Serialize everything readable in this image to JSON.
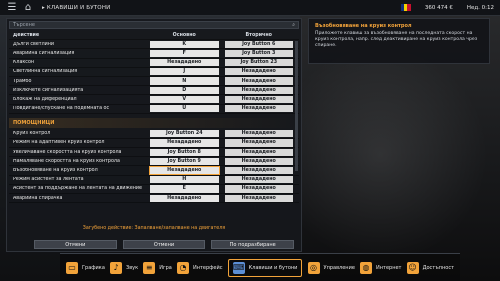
{
  "topbar": {
    "title": "КЛАВИШИ И БУТОНИ",
    "money": "360 474 €",
    "status": "Нед. 0:12"
  },
  "search": {
    "placeholder": "Търсене"
  },
  "list": {
    "header": {
      "action": "Действие",
      "primary": "Основно",
      "secondary": "Вторично"
    },
    "rows_top": [
      {
        "name": "Дълги светлини",
        "primary": "K",
        "secondary": "Joy Button 6"
      },
      {
        "name": "Аварийна сигнализация",
        "primary": "F",
        "secondary": "Joy Button 3"
      },
      {
        "name": "Клаксон",
        "primary": "Незададено",
        "secondary": "Joy Button 23"
      },
      {
        "name": "Светлинна сигнализация",
        "primary": "J",
        "secondary": "Незададено"
      },
      {
        "name": "Трамбо",
        "primary": "N",
        "secondary": "Незададено"
      },
      {
        "name": "Изключете сигнализацията",
        "primary": "D",
        "secondary": "Незададено"
      },
      {
        "name": "Блокаж на диференциал",
        "primary": "V",
        "secondary": "Незададено"
      },
      {
        "name": "Повдигане/спускане на подемната ос",
        "primary": "U",
        "secondary": "Незададено"
      }
    ],
    "section_title": "ПОМОЩНИЦИ",
    "rows_bottom": [
      {
        "name": "Круиз контрол",
        "primary": "Joy Button 24",
        "secondary": "Незададено"
      },
      {
        "name": "Режим на адаптивен круиз контрол",
        "primary": "Незададено",
        "secondary": "Незададено"
      },
      {
        "name": "Увеличаване скоростта на круиз контрола",
        "primary": "Joy Button 8",
        "secondary": "Незададено"
      },
      {
        "name": "Намаляване скоростта на круиз контрола",
        "primary": "Joy Button 9",
        "secondary": "Незададено"
      },
      {
        "name": "Възобновяване на круиз контрол",
        "primary": "Незададено",
        "secondary": "Незададено"
      },
      {
        "name": "Режим асистент за лентата",
        "primary": "H",
        "secondary": "Незададено"
      },
      {
        "name": "Асистент за поддържане на лентата на движение",
        "primary": "E",
        "secondary": "Незададено"
      },
      {
        "name": "Аварийна спирачка",
        "primary": "Незададено",
        "secondary": "Незададено"
      }
    ]
  },
  "info": {
    "title": "Възобновяване на круиз контрол",
    "text": "Приложете клавиш за възобновяване на последната скорост на круиз контрола, напр. след деактивиране на круиз контрола чрез спиране."
  },
  "note": "Загубено действие: Запалване/запалване на двигателя",
  "buttons": {
    "cancel": "Отмени",
    "apply": "Отмени",
    "default": "По подразбиране"
  },
  "tabs": [
    {
      "label": "Графика",
      "icon": "display-icon"
    },
    {
      "label": "Звук",
      "icon": "speaker-icon"
    },
    {
      "label": "Игра",
      "icon": "sliders-icon"
    },
    {
      "label": "Интерфейс",
      "icon": "gauge-icon"
    },
    {
      "label": "Клавиши и бутони",
      "icon": "gamepad-icon"
    },
    {
      "label": "Управление",
      "icon": "steering-icon"
    },
    {
      "label": "Интернет",
      "icon": "globe-icon"
    },
    {
      "label": "Достъпност",
      "icon": "accessibility-icon"
    }
  ],
  "colors": {
    "accent": "#f2a33a"
  }
}
